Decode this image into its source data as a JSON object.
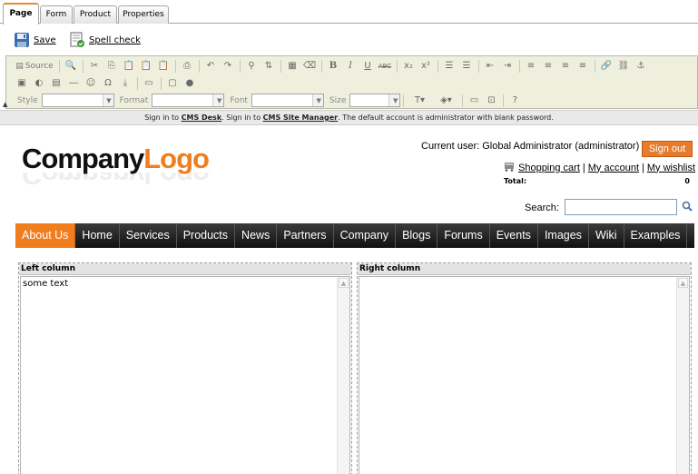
{
  "tabs": [
    "Page",
    "Form",
    "Product",
    "Properties"
  ],
  "actions": {
    "save": "Save",
    "spell": "Spell check"
  },
  "editor": {
    "source": "Source",
    "style_label": "Style",
    "format_label": "Format",
    "font_label": "Font",
    "size_label": "Size"
  },
  "signin": {
    "prefix1": "Sign in to",
    "link1": "CMS Desk",
    "prefix2": ". Sign in to",
    "link2": "CMS Site Manager",
    "suffix": ". The default account is administrator with blank password."
  },
  "header": {
    "logo_part1": "Company",
    "logo_part2": "Logo",
    "current_user": "Current user:  Global Administrator (administrator)",
    "sign_out": "Sign out",
    "shopping_cart": "Shopping cart",
    "sep": "|",
    "my_account": "My account",
    "my_wishlist": "My wishlist",
    "total_label": "Total:",
    "total_value": "0",
    "search_label": "Search:"
  },
  "nav": [
    "About Us",
    "Home",
    "Services",
    "Products",
    "News",
    "Partners",
    "Company",
    "Blogs",
    "Forums",
    "Events",
    "Images",
    "Wiki",
    "Examples"
  ],
  "columns": {
    "left_title": "Left column",
    "left_text": "some text",
    "right_title": "Right column"
  },
  "colors": {
    "accent": "#f07d1e",
    "nav_bg": "#1e1e1e",
    "toolbar_bg": "#efefde"
  }
}
